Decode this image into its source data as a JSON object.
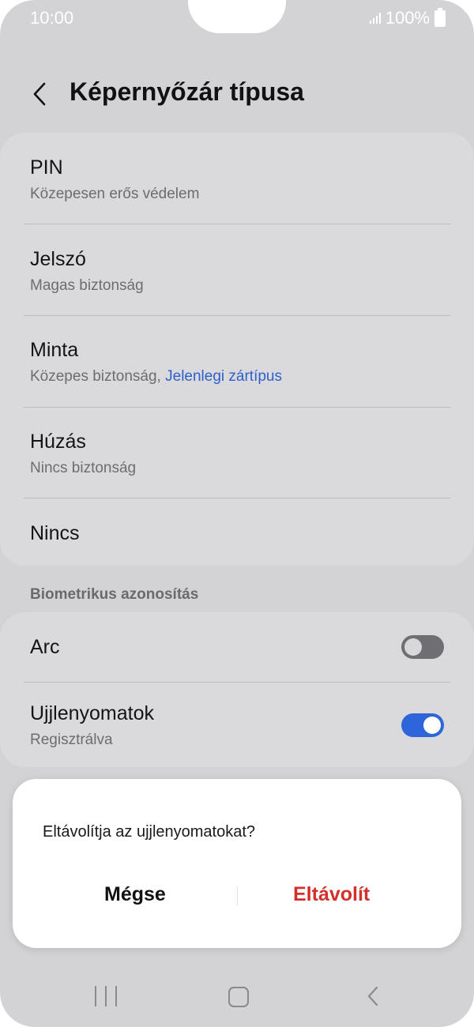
{
  "status": {
    "time": "10:00",
    "battery": "100%"
  },
  "header": {
    "title": "Képernyőzár típusa"
  },
  "lock_types": [
    {
      "title": "PIN",
      "sub": "Közepesen erős védelem"
    },
    {
      "title": "Jelszó",
      "sub": "Magas biztonság"
    },
    {
      "title": "Minta",
      "sub": "Közepes biztonság, ",
      "sub_accent": "Jelenlegi zártípus"
    },
    {
      "title": "Húzás",
      "sub": "Nincs biztonság"
    },
    {
      "title": "Nincs"
    }
  ],
  "biometrics": {
    "section_label": "Biometrikus azonosítás",
    "face": {
      "title": "Arc",
      "enabled": false
    },
    "fingerprint": {
      "title": "Ujjlenyomatok",
      "sub": "Regisztrálva",
      "enabled": true
    }
  },
  "dialog": {
    "message": "Eltávolítja az ujjlenyomatokat?",
    "cancel_label": "Mégse",
    "remove_label": "Eltávolít"
  },
  "colors": {
    "accent": "#2e5fcc",
    "danger": "#d4302a",
    "background": "#d3d3d6"
  },
  "icons": {
    "back": "chevron-left-icon",
    "recents": "recents-icon",
    "home": "home-icon",
    "nav_back": "nav-back-icon"
  }
}
